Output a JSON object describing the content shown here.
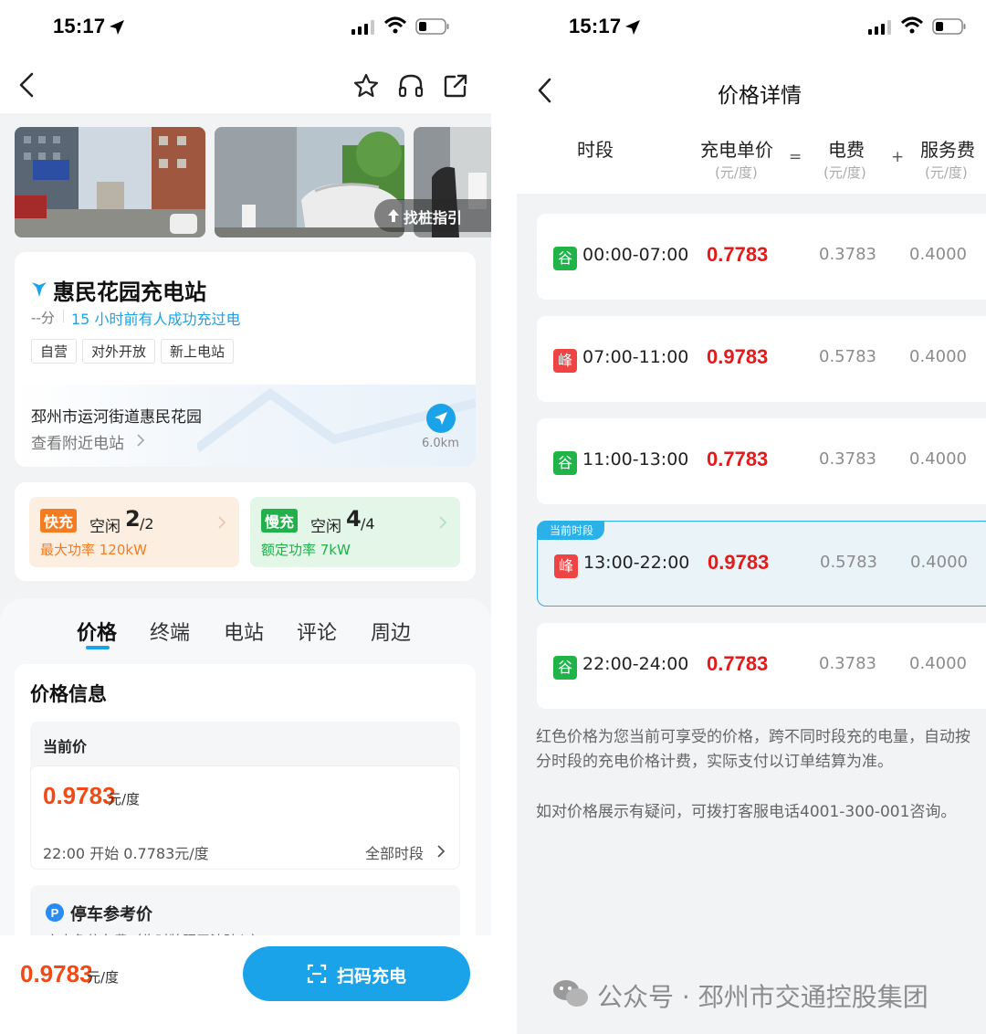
{
  "left": {
    "status_time": "15:17",
    "gallery": {
      "find_pile_label": "找桩指引"
    },
    "station": {
      "name": "惠民花园充电站",
      "score": "--分",
      "last_charge": "15 小时前有人成功充过电",
      "tags": [
        "自营",
        "对外开放",
        "新上电站"
      ],
      "address": "邳州市运河街道惠民花园",
      "nearby_link": "查看附近电站",
      "distance": "6.0km"
    },
    "fast": {
      "badge": "快充",
      "idle_label": "空闲",
      "idle_value": "2",
      "total": "/2",
      "power": "最大功率 120kW"
    },
    "slow": {
      "badge": "慢充",
      "idle_label": "空闲",
      "idle_value": "4",
      "total": "/4",
      "power": "额定功率 7kW"
    },
    "tabs": [
      "价格",
      "终端",
      "电站",
      "评论",
      "周边"
    ],
    "price_info": {
      "title": "价格信息",
      "current_label": "当前价",
      "current_price": "0.9783",
      "unit": "元/度",
      "next_start": "22:00 开始 0.7783元/度",
      "all_periods": "全部时段"
    },
    "parking": {
      "title": "停车参考价",
      "desc": "充电免停车费（临时牌照无法驶入）"
    },
    "bottom": {
      "price": "0.9783",
      "unit": "元/度",
      "scan_button": "扫码充电"
    }
  },
  "right": {
    "status_time": "15:17",
    "title": "价格详情",
    "headers": {
      "period": "时段",
      "unit_price": "充电单价",
      "unit_price_unit": "(元/度)",
      "eq": "=",
      "elec": "电费",
      "elec_unit": "(元/度)",
      "plus": "+",
      "service": "服务费",
      "service_unit": "(元/度)"
    },
    "current_flag": "当前时段",
    "periods": [
      {
        "badge": "谷",
        "time": "00:00-07:00",
        "price": "0.7783",
        "elec": "0.3783",
        "service": "0.4000"
      },
      {
        "badge": "峰",
        "time": "07:00-11:00",
        "price": "0.9783",
        "elec": "0.5783",
        "service": "0.4000"
      },
      {
        "badge": "谷",
        "time": "11:00-13:00",
        "price": "0.7783",
        "elec": "0.3783",
        "service": "0.4000"
      },
      {
        "badge": "峰",
        "time": "13:00-22:00",
        "price": "0.9783",
        "elec": "0.5783",
        "service": "0.4000"
      },
      {
        "badge": "谷",
        "time": "22:00-24:00",
        "price": "0.7783",
        "elec": "0.3783",
        "service": "0.4000"
      }
    ],
    "note1": "红色价格为您当前可享受的价格，跨不同时段充的电量，自动按分时段的充电价格计费，实际支付以订单结算为准。",
    "note2": "如对价格展示有疑问，可拨打客服电话4001-300-001咨询。",
    "watermark": "公众号 · 邳州市交通控股集团"
  },
  "colors": {
    "accent": "#1aa3e8",
    "price_red": "#e31b1b",
    "fast_orange": "#f47b20",
    "slow_green": "#22b04b"
  }
}
